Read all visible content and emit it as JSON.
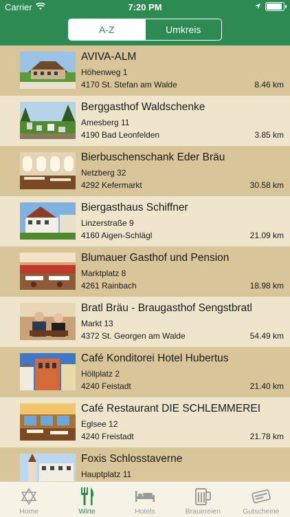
{
  "status_bar": {
    "carrier": "Carrier",
    "time": "7:20 PM",
    "battery_level": 0.9
  },
  "segments": [
    {
      "label": "A-Z",
      "selected": true
    },
    {
      "label": "Umkreis",
      "selected": false
    }
  ],
  "restaurants": [
    {
      "name": "AVIVA-ALM",
      "street": "Höhenweg 1",
      "city": "4170 St. Stefan am Walde",
      "distance": "8.46 km"
    },
    {
      "name": "Berggasthof Waldschenke",
      "street": "Amesberg 11",
      "city": "4190 Bad Leonfelden",
      "distance": "3.85 km"
    },
    {
      "name": "Bierbuschenschank Eder Bräu",
      "street": "Netzberg 32",
      "city": "4292 Kefermarkt",
      "distance": "30.58 km"
    },
    {
      "name": "Biergasthaus Schiffner",
      "street": "Linzerstraße 9",
      "city": "4160 Aigen-Schlägl",
      "distance": "21.09 km"
    },
    {
      "name": "Blumauer Gasthof und Pension",
      "street": "Marktplatz 8",
      "city": "4261 Rainbach",
      "distance": "18.98 km"
    },
    {
      "name": "Bratl Bräu - Braugasthof Sengstbratl",
      "street": "Markt 13",
      "city": "4372 St. Georgen am Walde",
      "distance": "54.49 km"
    },
    {
      "name": "Café Konditorei Hotel Hubertus",
      "street": "Höllplatz 2",
      "city": "4240 Feistadt",
      "distance": "21.40 km"
    },
    {
      "name": "Café Restaurant DIE SCHLEMMEREI",
      "street": "Eglsee 12",
      "city": "4240 Freistadt",
      "distance": "21.78 km"
    },
    {
      "name": "Foxis Schlosstaverne",
      "street": "Hauptplatz 11",
      "city": "",
      "distance": ""
    }
  ],
  "tabs": [
    {
      "label": "Home",
      "icon": "star-of-david-icon",
      "active": false
    },
    {
      "label": "Wirte",
      "icon": "fork-knife-icon",
      "active": true
    },
    {
      "label": "Hotels",
      "icon": "bed-icon",
      "active": false
    },
    {
      "label": "Brauereien",
      "icon": "beer-mug-icon",
      "active": false
    },
    {
      "label": "Gutscheine",
      "icon": "voucher-icon",
      "active": false
    }
  ],
  "colors": {
    "header": "#2d8a52",
    "row_odd": "#d9c59a",
    "row_even": "#efe5cc",
    "tab_active": "#2d8a52",
    "tab_inactive": "#9a9a9a"
  }
}
